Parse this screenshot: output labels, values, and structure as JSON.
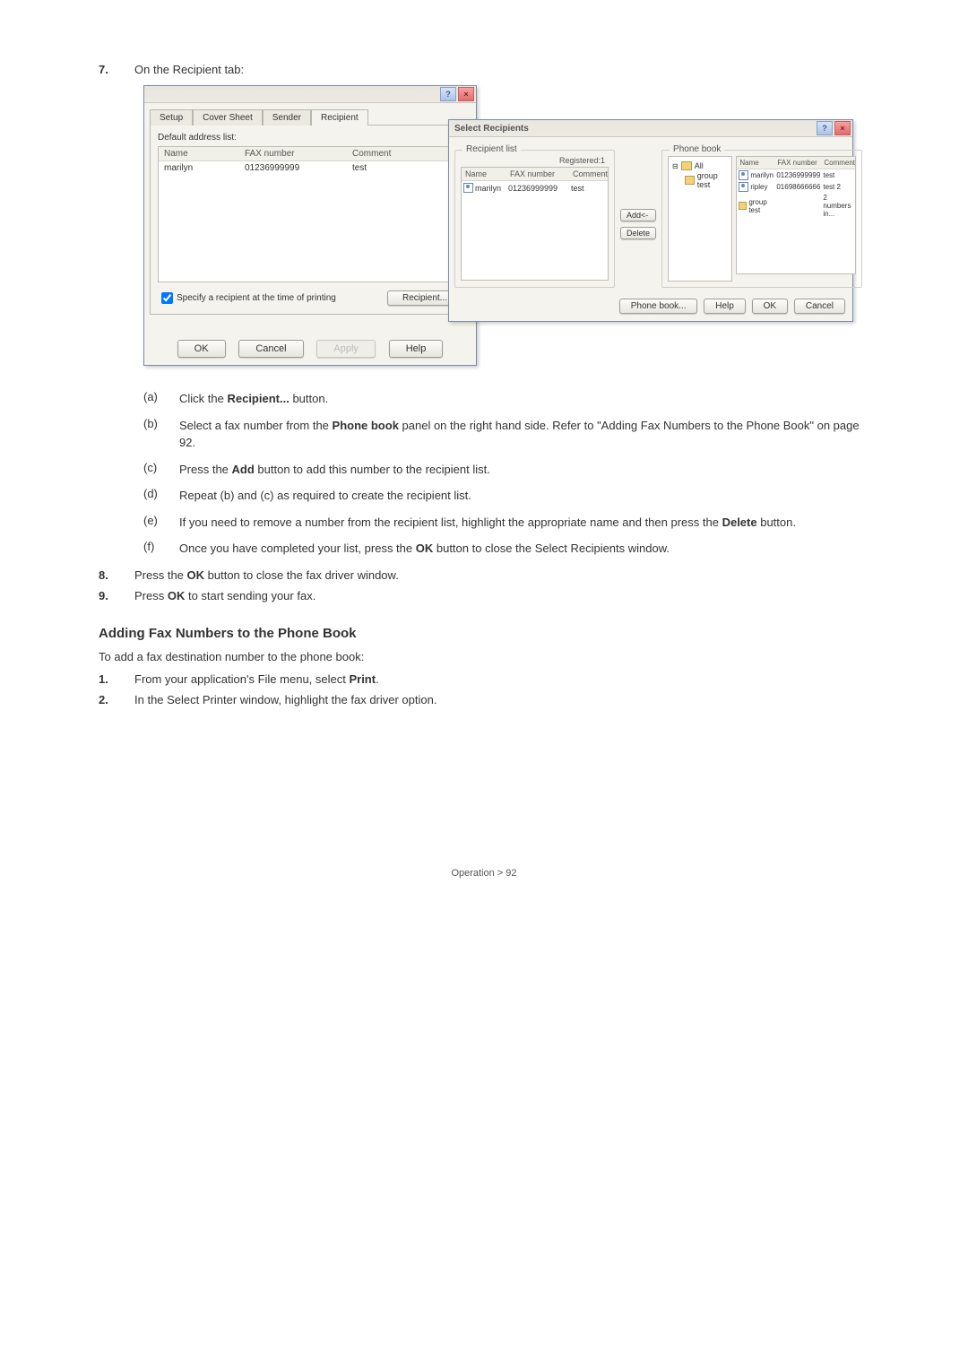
{
  "steps": {
    "s7": {
      "num": "7.",
      "text": "On the Recipient tab:"
    },
    "s8": {
      "num": "8.",
      "text_a": "Press the ",
      "bold": "OK",
      "text_b": " button to close the fax driver window."
    },
    "s9": {
      "num": "9.",
      "text_a": "Press ",
      "bold": "OK",
      "text_b": " to start sending your fax."
    }
  },
  "substeps": {
    "a": {
      "mark": "(a)",
      "t1": "Click the ",
      "b1": "Recipient...",
      "t2": " button."
    },
    "b": {
      "mark": "(b)",
      "t1": "Select a fax number from the ",
      "b1": "Phone book",
      "t2": " panel on the right hand side. Refer to \"Adding Fax Numbers to the Phone Book\" on page 92."
    },
    "c": {
      "mark": "(c)",
      "t1": "Press the ",
      "b1": "Add",
      "t2": " button to add this number to the recipient list."
    },
    "d": {
      "mark": "(d)",
      "t1": "Repeat (b) and (c) as required to create the recipient list."
    },
    "e": {
      "mark": "(e)",
      "t1": "If you need to remove a number from the recipient list, highlight the appropriate name and then press the ",
      "b1": "Delete",
      "t2": " button."
    },
    "f": {
      "mark": "(f)",
      "t1": "Once you have completed your list, press the ",
      "b1": "OK",
      "t2": " button to close the Select Recipients window."
    }
  },
  "section": {
    "title": "Adding Fax Numbers to the Phone Book",
    "intro": "To add a fax destination number to the phone book:",
    "s1": {
      "num": "1.",
      "t1": "From your application's File menu, select ",
      "b1": "Print",
      "t2": "."
    },
    "s2": {
      "num": "2.",
      "t1": "In the Select Printer window, highlight the fax driver option."
    }
  },
  "footer": "Operation > 92",
  "dlg1": {
    "tabs": {
      "setup": "Setup",
      "cover": "Cover Sheet",
      "sender": "Sender",
      "recipient": "Recipient"
    },
    "default_label": "Default address list:",
    "cols": {
      "name": "Name",
      "fax": "FAX number",
      "comment": "Comment"
    },
    "row": {
      "name": "marilyn",
      "fax": "01236999999",
      "comment": "test"
    },
    "checkbox": "Specify a recipient at the time of printing",
    "recipient_btn": "Recipient...",
    "ok": "OK",
    "cancel": "Cancel",
    "apply": "Apply",
    "help": "Help",
    "title_help": "?",
    "title_close": "×"
  },
  "dlg2": {
    "title": "Select Recipients",
    "box_recipient": "Recipient list",
    "box_phone": "Phone book",
    "registered": "Registered:1",
    "cols": {
      "name": "Name",
      "fax": "FAX number",
      "comment": "Comment"
    },
    "row": {
      "name": "marilyn",
      "fax": "01236999999",
      "comment": "test"
    },
    "tree": {
      "all": "All",
      "group": "group test",
      "contacts": {
        "c1": {
          "name": "marilyn",
          "fax": "01236999999",
          "comment": "test"
        },
        "c2": {
          "name": "ripley",
          "fax": "01698666666",
          "comment": "test 2"
        },
        "c3": {
          "name": "group test",
          "fax": "",
          "comment": "2 numbers in..."
        }
      }
    },
    "add": "Add<-",
    "delete": "Delete",
    "btns": {
      "phonebook": "Phone book...",
      "help": "Help",
      "ok": "OK",
      "cancel": "Cancel"
    },
    "title_help": "?",
    "title_close": "×"
  }
}
